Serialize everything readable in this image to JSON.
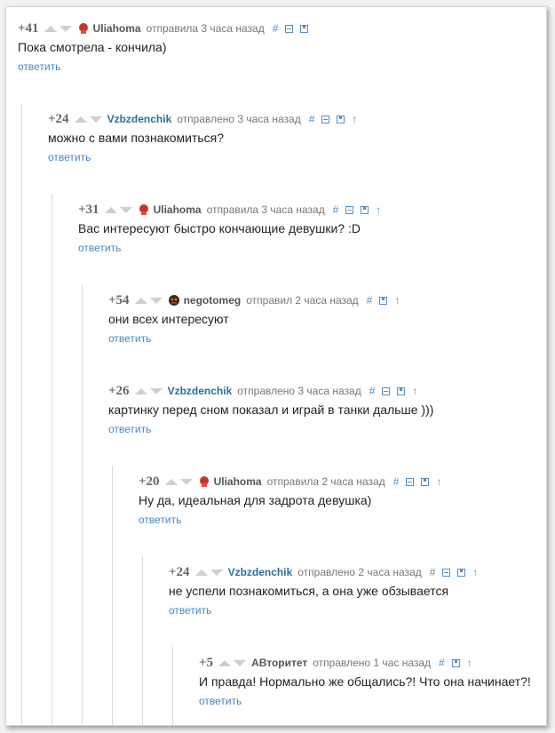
{
  "colors": {
    "author_blue": "#2c6f9e",
    "link_blue": "#4a86c0"
  },
  "comments": [
    {
      "rating": "+41",
      "author": "Uliahoma",
      "avatar_icon": "red-avatar-icon",
      "time": "отправила 3 часа назад",
      "hash": "#",
      "text": "Пока смотрела - кончила)",
      "reply": "ответить"
    },
    {
      "rating": "+24",
      "author": "Vzbzdenchik",
      "time": "отправлено 3 часа назад",
      "hash": "#",
      "up": "↑",
      "text": "можно с вами познакомиться?",
      "reply": "ответить"
    },
    {
      "rating": "+31",
      "author": "Uliahoma",
      "avatar_icon": "red-avatar-icon",
      "time": "отправила 3 часа назад",
      "hash": "#",
      "up": "↑",
      "text": "Вас интересуют быстро кончающие девушки? :D",
      "reply": "ответить"
    },
    {
      "rating": "+54",
      "author": "negotomeg",
      "avatar_icon": "dark-avatar-icon",
      "time": "отправил 2 часа назад",
      "hash": "#",
      "up": "↑",
      "text": "они всех интересуют",
      "reply": "ответить"
    },
    {
      "rating": "+26",
      "author": "Vzbzdenchik",
      "time": "отправлено 3 часа назад",
      "hash": "#",
      "up": "↑",
      "text": "картинку перед сном показал и играй в танки дальше )))",
      "reply": "ответить"
    },
    {
      "rating": "+20",
      "author": "Uliahoma",
      "avatar_icon": "red-avatar-icon",
      "time": "отправила 2 часа назад",
      "hash": "#",
      "up": "↑",
      "text": "Ну да, идеальная для задрота девушка)",
      "reply": "ответить"
    },
    {
      "rating": "+24",
      "author": "Vzbzdenchik",
      "time": "отправлено 2 часа назад",
      "hash": "#",
      "up": "↑",
      "text": "не успели познакомиться, а она уже обзывается",
      "reply": "ответить"
    },
    {
      "rating": "+5",
      "author": "АВторитет",
      "time": "отправлено 1 час назад",
      "hash": "#",
      "up": "↑",
      "text": "И правда! Нормально же общались?! Что она начинает?!",
      "reply": "ответить"
    }
  ]
}
